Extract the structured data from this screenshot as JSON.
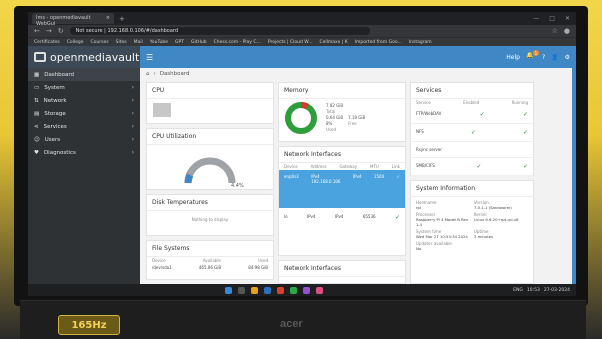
{
  "browser": {
    "tab_title": "Ims - openmediavault WebGui",
    "tab_close": "×",
    "new_tab": "+",
    "address": "Not secure | 192.168.0.106/#/dashboard",
    "bookmarks": [
      "Certificates",
      "College",
      "Courses",
      "Sites",
      "Mail",
      "YouTube",
      "GPT",
      "GitHub",
      "Chess.com - Play C...",
      "Projects | Cloud W...",
      "Cellmaxx | K",
      "Imported from Goo...",
      "Instagram"
    ]
  },
  "app": {
    "brand": "openmediavault",
    "sidebar": [
      {
        "label": "Dashboard",
        "active": true,
        "chev": ""
      },
      {
        "label": "System",
        "active": false,
        "chev": "›"
      },
      {
        "label": "Network",
        "active": false,
        "chev": "›"
      },
      {
        "label": "Storage",
        "active": false,
        "chev": "›"
      },
      {
        "label": "Services",
        "active": false,
        "chev": "›"
      },
      {
        "label": "Users",
        "active": false,
        "chev": "›"
      },
      {
        "label": "Diagnostics",
        "active": false,
        "chev": "›"
      }
    ],
    "breadcrumb": "Dashboard",
    "topbar_user": "Help",
    "notif_count": "1",
    "cpu": {
      "title": "CPU"
    },
    "cpu_util": {
      "title": "CPU Utilization",
      "value": "4.4%"
    },
    "disk_temps": {
      "title": "Disk Temperatures",
      "empty": "Nothing to display"
    },
    "filesystems": {
      "title": "File Systems",
      "headers": [
        "Device",
        "Available",
        "Used"
      ],
      "row": [
        "/dev/sda1",
        "465.06 GiB",
        "84.98 GiB"
      ]
    },
    "memory": {
      "title": "Memory",
      "total": "7.82 GiB",
      "total_label": "Total",
      "used_pct": "8%",
      "free": "7.19 GiB",
      "used": "0.64 GiB",
      "used_label": "Used",
      "free_label": "Free"
    },
    "net": {
      "title": "Network Interfaces",
      "headers": [
        "Device",
        "Address",
        "Gateway",
        "MTU",
        "Link"
      ],
      "rows": [
        [
          "enp0s3",
          "IPv4",
          "IPv4",
          "1500",
          "✓"
        ],
        [
          "lo",
          "IPv4",
          "IPv4",
          "65536",
          "✓"
        ]
      ],
      "ip": "192.168.0.106"
    },
    "services": {
      "title": "Services",
      "headers": [
        "Service",
        "Enabled",
        "Running"
      ],
      "rows": [
        [
          "FTP/WebDAV",
          "✓",
          "✓"
        ],
        [
          "NFS",
          "✓",
          "✓"
        ],
        [
          "Rsync server",
          "",
          ""
        ],
        [
          "SMB/CIFS",
          "✓",
          "✓"
        ]
      ]
    },
    "sysinfo": {
      "title": "System Information",
      "hostname_label": "Hostname",
      "hostname": "rpi",
      "version_label": "Version",
      "version": "7.0.1-1 (Sandworm)",
      "processor_label": "Processor",
      "processor": "Raspberry Pi 4 Model B Rev 1.4",
      "kernel_label": "Kernel",
      "kernel": "Linux 6.6.20+rpt-rpi-v8",
      "time_label": "System time",
      "time": "Wed Mar 27 10:53:34 2024",
      "uptime_label": "Uptime",
      "uptime": "3 minutes",
      "updates_label": "Updates available",
      "updates": "No"
    },
    "net2": {
      "title": "Network Interfaces"
    }
  },
  "taskbar": {
    "time": "10:53",
    "date": "27-03-2024",
    "lang": "ENG"
  },
  "bezel": {
    "badge": "165Hz",
    "brand": "acer"
  },
  "colors": {
    "topbar": "#3f88c5",
    "sidebar": "#2e3235",
    "memory_free": "#2e9e3a",
    "memory_used": "#d23b2e",
    "net_selected": "#4aa3df"
  }
}
